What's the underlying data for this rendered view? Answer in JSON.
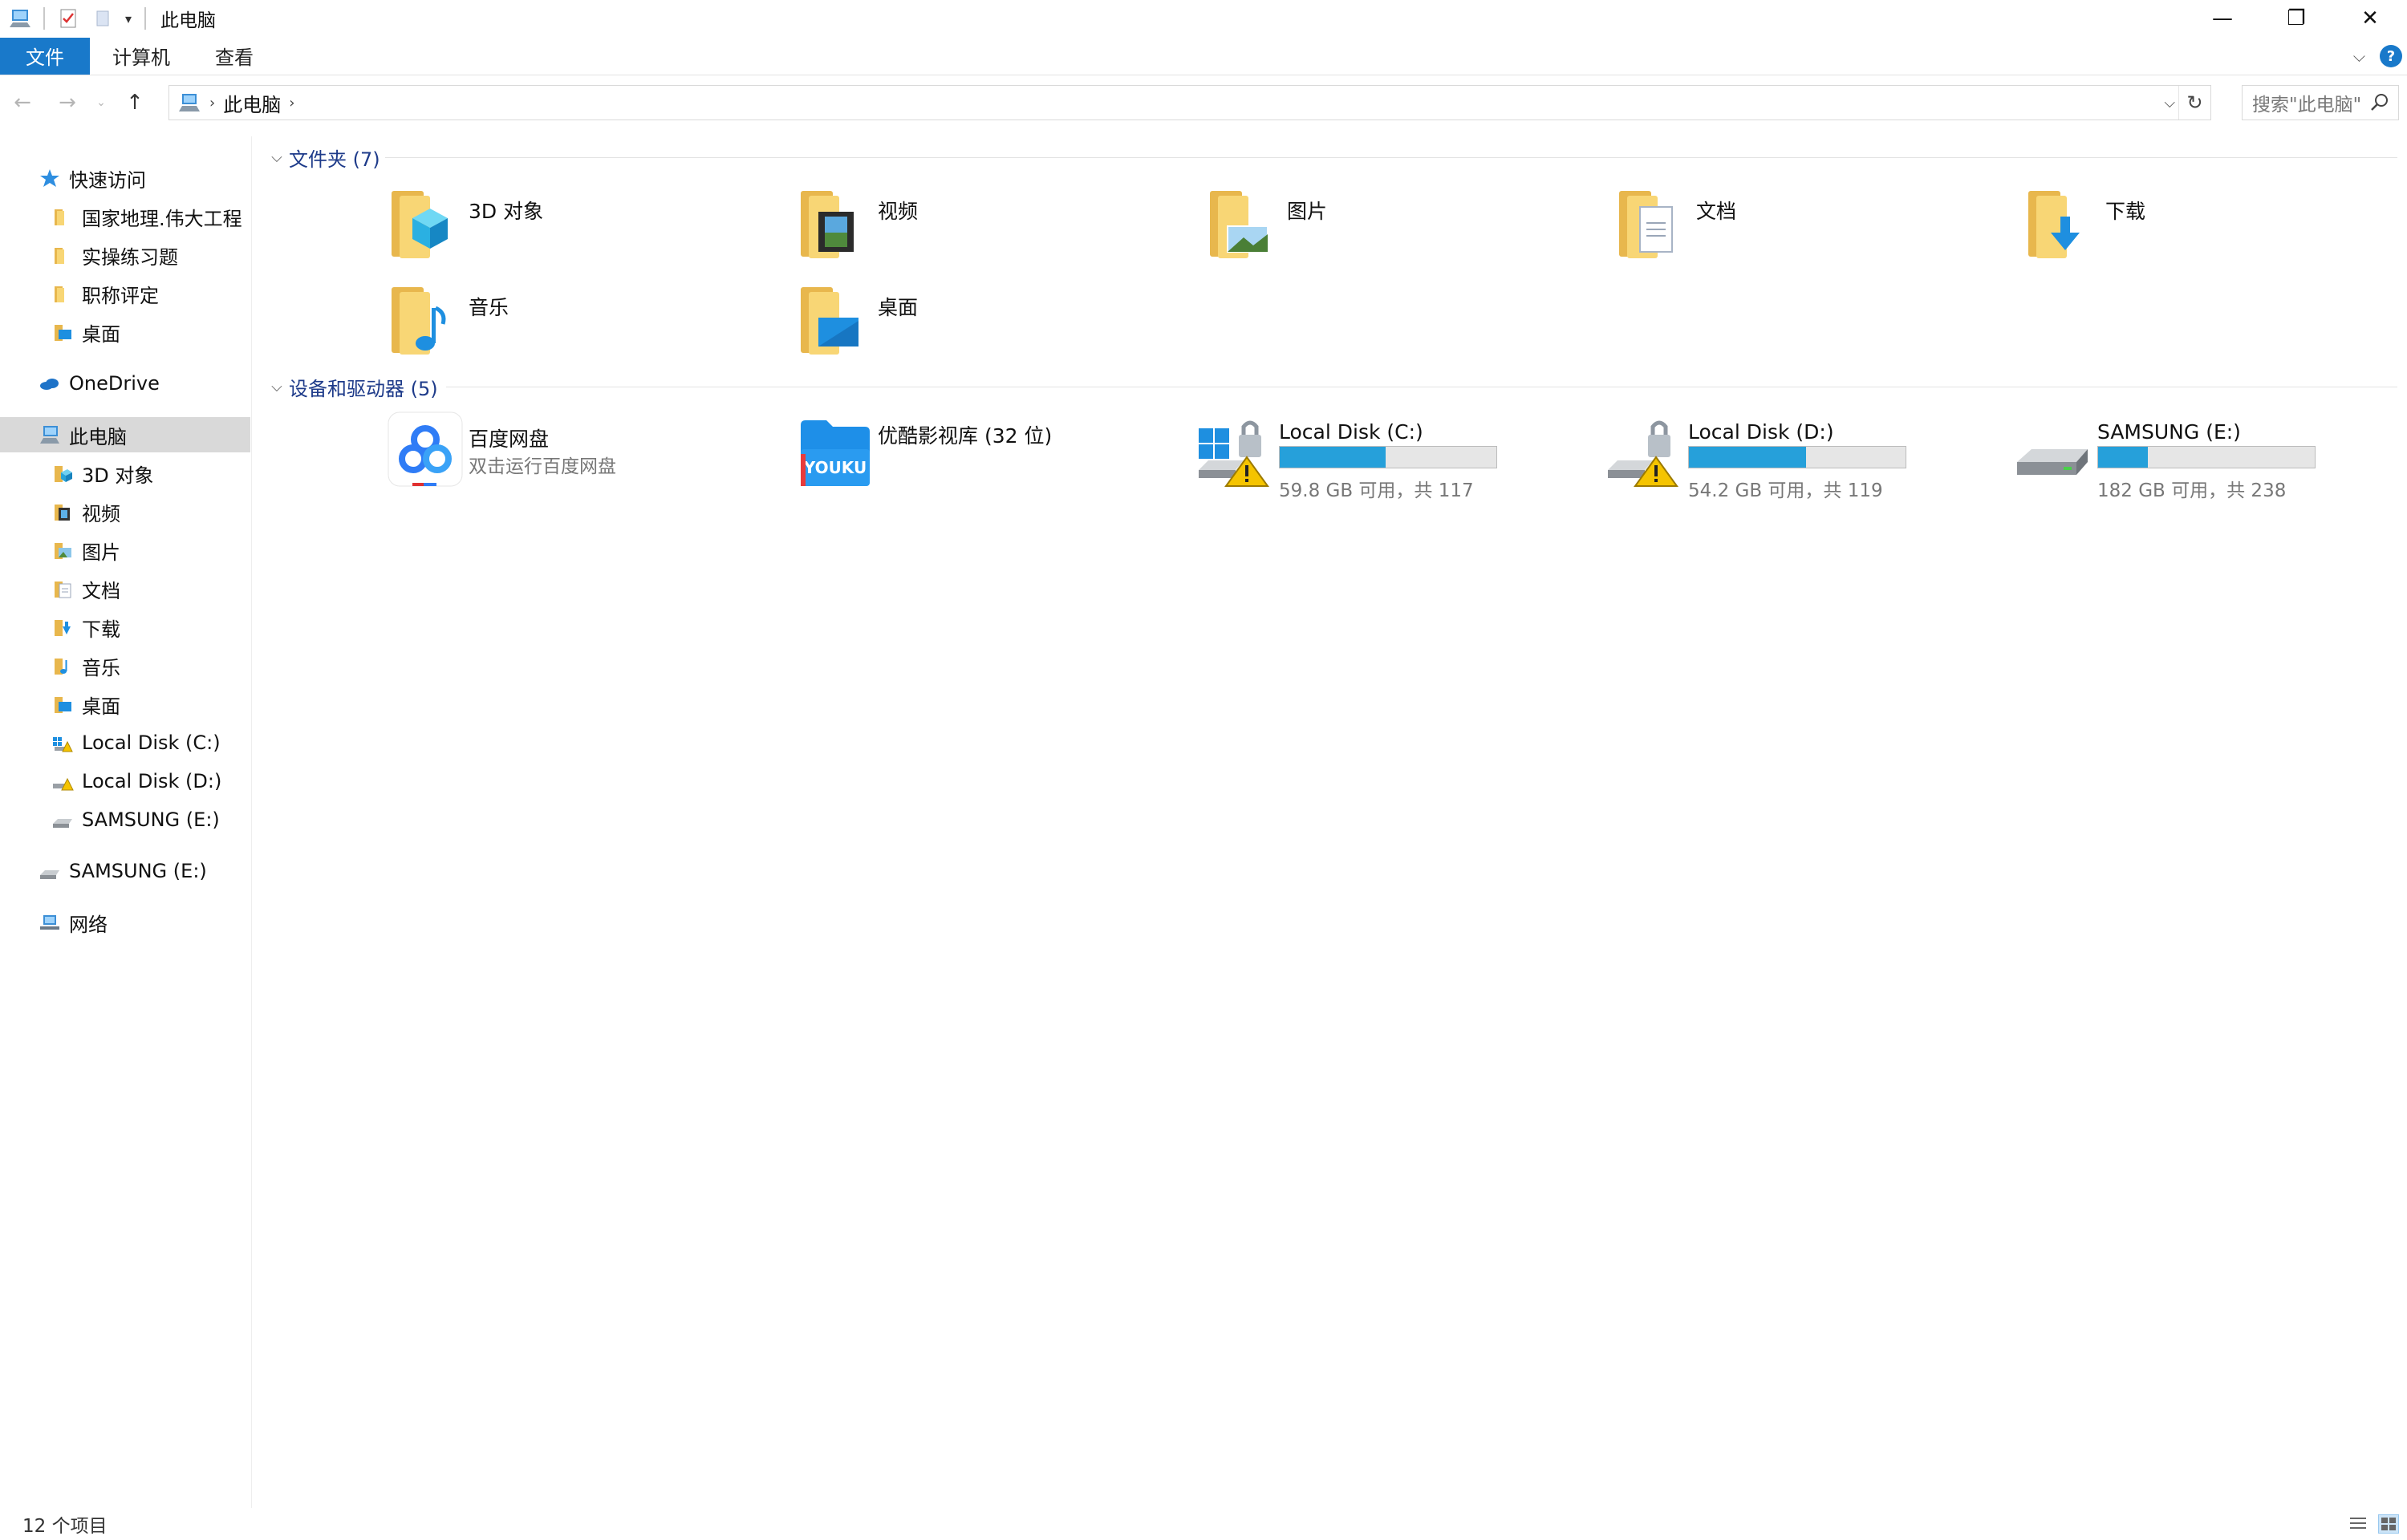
{
  "titlebar": {
    "title": "此电脑",
    "minimize": "—",
    "maximize": "❐",
    "close": "✕"
  },
  "ribbon": {
    "tabs": [
      "文件",
      "计算机",
      "查看"
    ],
    "help": "?"
  },
  "address": {
    "path": "此电脑",
    "search_placeholder": "搜索\"此电脑\""
  },
  "sidebar": {
    "quick_access": "快速访问",
    "quick_items": [
      "国家地理.伟大工程",
      "实操练习题",
      "职称评定",
      "桌面"
    ],
    "onedrive": "OneDrive",
    "this_pc": "此电脑",
    "pc_items": [
      "3D 对象",
      "视频",
      "图片",
      "文档",
      "下载",
      "音乐",
      "桌面",
      "Local Disk (C:)",
      "Local Disk (D:)",
      "SAMSUNG (E:)"
    ],
    "samsung": "SAMSUNG (E:)",
    "network": "网络"
  },
  "folders": {
    "header": "文件夹 (7)",
    "items": [
      "3D 对象",
      "视频",
      "图片",
      "文档",
      "下载",
      "音乐",
      "桌面"
    ]
  },
  "devices": {
    "header": "设备和驱动器 (5)",
    "apps": [
      {
        "name": "百度网盘",
        "sub": "双击运行百度网盘"
      },
      {
        "name": "优酷影视库 (32 位)"
      }
    ],
    "drives": [
      {
        "name": "Local Disk (C:)",
        "free": "59.8 GB 可用，共 117",
        "used_fraction": 0.49
      },
      {
        "name": "Local Disk (D:)",
        "free": "54.2 GB 可用，共 119",
        "used_fraction": 0.54
      },
      {
        "name": "SAMSUNG (E:)",
        "free": "182 GB 可用，共 238",
        "used_fraction": 0.23
      }
    ]
  },
  "status": {
    "count": "12 个项目"
  },
  "colors": {
    "accent": "#1979ca",
    "drive_bar": "#26a0da",
    "group_header": "#1e3b8a",
    "folder_yellow": "#f8d675"
  }
}
